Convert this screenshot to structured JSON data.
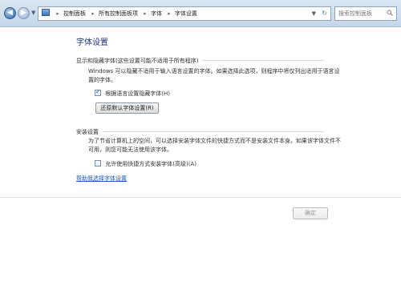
{
  "address_bar": {
    "crumbs": [
      "控制面板",
      "所有控制面板项",
      "字体",
      "字体设置"
    ]
  },
  "search": {
    "placeholder": "搜索控制面板"
  },
  "main": {
    "title": "字体设置",
    "hide_section": {
      "heading": "显示和隐藏字体(这些设置可能不适用于所有程序)",
      "description_line1": "Windows 可以隐藏不适用于输入语言设置的字体。如果选择此选项，则程序中将仅列出适用于语言设",
      "description_line2": "置的字体。",
      "checkbox_label": "根据语言设置隐藏字体(H)",
      "checkbox_checked": true,
      "restore_button": "还原默认字体设置(R)"
    },
    "install_section": {
      "heading": "安装设置",
      "description_line1": "为了节省计算机上的空间，可以选择安装字体文件的快捷方式而不是安装文件本身。如果该字体文件不",
      "description_line2": "可用，则您可能无法使用该字体。",
      "checkbox_label": "允许使用快捷方式安装字体(高级)(A)",
      "checkbox_checked": false
    },
    "help_link": "帮助我选择字体设置"
  },
  "footer": {
    "ok_button": "确定"
  }
}
